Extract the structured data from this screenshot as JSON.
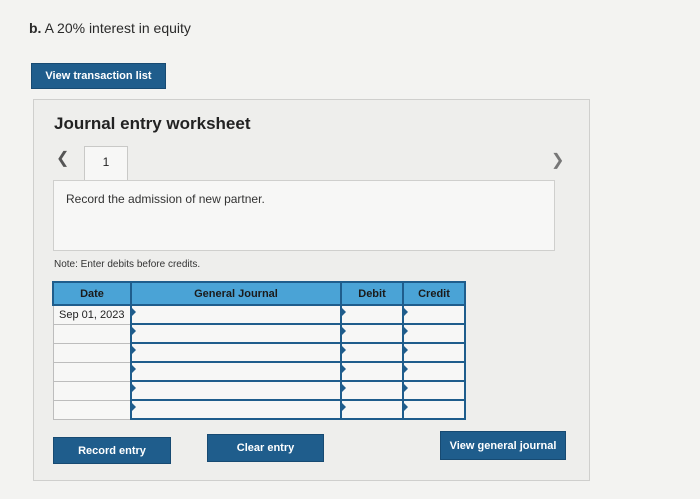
{
  "heading": {
    "prefix": "b.",
    "text": "A 20% interest in equity"
  },
  "buttons": {
    "view_transaction_list": "View transaction list",
    "record_entry": "Record entry",
    "clear_entry": "Clear entry",
    "view_general_journal": "View general journal"
  },
  "worksheet": {
    "title": "Journal entry worksheet",
    "current_tab": "1",
    "description": "Record the admission of new partner.",
    "note": "Note: Enter debits before credits."
  },
  "table": {
    "headers": {
      "date": "Date",
      "general_journal": "General Journal",
      "debit": "Debit",
      "credit": "Credit"
    },
    "rows": [
      {
        "date": "Sep 01, 2023",
        "account": "",
        "debit": "",
        "credit": ""
      },
      {
        "date": "",
        "account": "",
        "debit": "",
        "credit": ""
      },
      {
        "date": "",
        "account": "",
        "debit": "",
        "credit": ""
      },
      {
        "date": "",
        "account": "",
        "debit": "",
        "credit": ""
      },
      {
        "date": "",
        "account": "",
        "debit": "",
        "credit": ""
      },
      {
        "date": "",
        "account": "",
        "debit": "",
        "credit": ""
      }
    ]
  },
  "icons": {
    "prev": "chevron-left-icon",
    "next": "chevron-right-icon"
  },
  "colors": {
    "button": "#1f5d8c",
    "header": "#4aa3d6"
  }
}
